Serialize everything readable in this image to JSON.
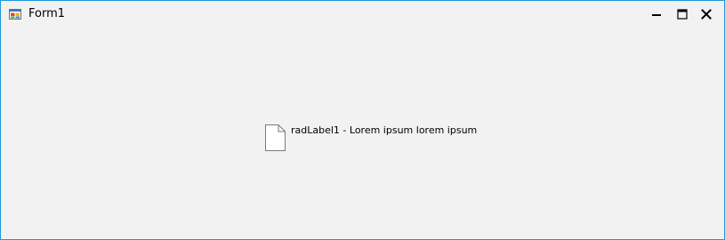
{
  "window": {
    "title": "Form1",
    "icons": {
      "app": "winforms-app-icon",
      "minimize": "minimize-icon",
      "maximize": "maximize-icon",
      "close": "close-icon",
      "document": "document-icon"
    },
    "border_color": "#1c9ad6"
  },
  "client": {
    "rad_label": {
      "text": "radLabel1 - Lorem ipsum lorem ipsum"
    }
  }
}
